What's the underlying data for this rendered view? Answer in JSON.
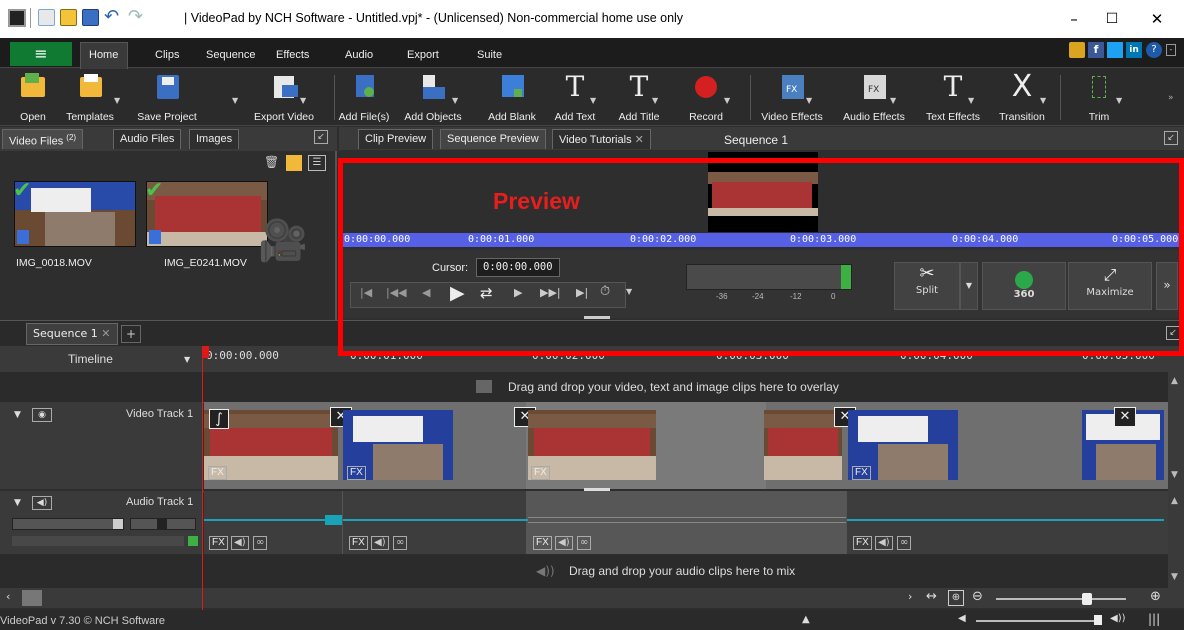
{
  "window": {
    "title": "| VideoPad by NCH Software - Untitled.vpj* - (Unlicensed) Non-commercial home use only",
    "min": "–",
    "max": "☐",
    "close": "✕"
  },
  "menu": {
    "hamburger": "≡",
    "tabs": [
      "Home",
      "Clips",
      "Sequence",
      "Effects",
      "Audio",
      "Export",
      "Suite"
    ]
  },
  "toolbar": {
    "buttons": [
      "Open",
      "Templates",
      "Save Project",
      "Export Video",
      "Add File(s)",
      "Add Objects",
      "Add Blank",
      "Add Text",
      "Add Title",
      "Record",
      "Video Effects",
      "Audio Effects",
      "Text Effects",
      "Transition",
      "Trim"
    ]
  },
  "media": {
    "tabs": [
      "Video Files",
      "Audio Files",
      "Images"
    ],
    "video_count": "(2)",
    "files": [
      "IMG_0018.MOV",
      "IMG_E0241.MOV"
    ]
  },
  "preview": {
    "tabs": [
      "Clip Preview",
      "Sequence Preview",
      "Video Tutorials"
    ],
    "sequence_title": "Sequence 1",
    "overlay_label": "Preview",
    "ruler_ticks": [
      "0:00:00.000",
      "0:00:01.000",
      "0:00:02.000",
      "0:00:03.000",
      "0:00:04.000",
      "0:00:05.000"
    ],
    "cursor_label": "Cursor:",
    "cursor_value": "0:00:00.000",
    "meter_ticks": [
      "-36",
      "-24",
      "-12",
      "0"
    ],
    "split_label": "Split",
    "vr_label": "360",
    "maximize_label": "Maximize"
  },
  "timeline": {
    "sequence_tab": "Sequence 1",
    "add_tab": "+",
    "mode": "Timeline",
    "ruler_ticks": [
      "0:00:00.000",
      "0:00:01.000",
      "0:00:02.000",
      "0:00:03.000",
      "0:00:04.000",
      "0:00:05.000"
    ],
    "overlay_hint": "Drag and drop your video, text and image clips here to overlay",
    "video_track": "Video Track 1",
    "audio_track": "Audio Track 1",
    "audio_hint": "Drag and drop your audio clips here to mix",
    "fx": "FX"
  },
  "status": {
    "text": "VideoPad v 7.30 © NCH Software"
  },
  "colors": {
    "accent_green": "#107a33",
    "highlight_red": "#ff0000",
    "ruler_blue": "#5560e6",
    "waveform": "#1aa3b8"
  }
}
